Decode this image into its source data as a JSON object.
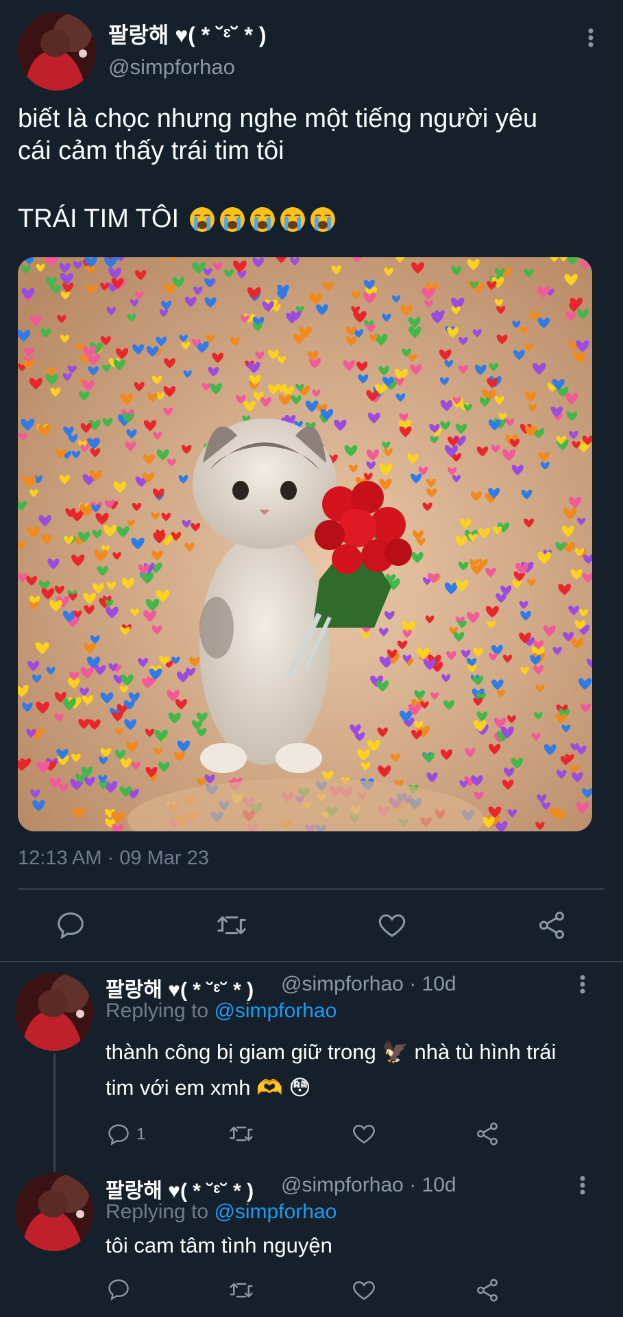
{
  "main_tweet": {
    "display_name": "팔랑해 ♥( * ˘ᵋ˘ * )",
    "handle": "@simpforhao",
    "text_line1": "biết là chọc nhưng nghe một tiếng người yêu",
    "text_line2": "cái cảm thấy trái tim tôi",
    "text_line3": "TRÁI TIM TÔI",
    "emoji_count": 5,
    "emoji_name": "loudly-crying-face",
    "timestamp": "12:13 AM · 09 Mar 23",
    "media_description_icon": "cat-with-roses-and-hearts-image"
  },
  "replies": [
    {
      "display_name": "팔랑해 ♥( * ˘ᵋ˘ * )",
      "meta": "@simpforhao · 10d",
      "replying_label": "Replying to",
      "replying_handle": "@simpforhao",
      "text_line1": "thành công bị giam giữ trong 🦅 nhà tù hình trái",
      "text_line2": "tim với em xmh 🫶 😳",
      "reply_count": "1"
    },
    {
      "display_name": "팔랑해 ♥( * ˘ᵋ˘ * )",
      "meta": "@simpforhao · 10d",
      "replying_label": "Replying to",
      "replying_handle": "@simpforhao",
      "text_line1": "tôi cam tâm tình nguyện",
      "reply_count": ""
    }
  ],
  "colors": {
    "background": "#15202b",
    "text": "#ffffff",
    "secondary": "#8b98a5",
    "link": "#1d9bf0",
    "divider": "#38444d"
  }
}
